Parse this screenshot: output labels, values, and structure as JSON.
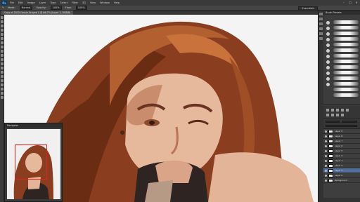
{
  "app": {
    "logo": "Ps",
    "menu": [
      "File",
      "Edit",
      "Image",
      "Layer",
      "Type",
      "Select",
      "Filter",
      "3D",
      "View",
      "Window",
      "Help"
    ],
    "window_controls": [
      "–",
      "□",
      "✕"
    ]
  },
  "options_bar": {
    "mode_label": "Mode:",
    "mode_value": "Normal",
    "opacity_label": "Opacity:",
    "opacity_value": "100%",
    "flow_label": "Flow:",
    "flow_value": "100%",
    "workspace": "Essentials"
  },
  "document": {
    "tab_title": "Copy of 2015 Cassie Grayed 1 @ 66.7% (Layer 1, RGB/8)"
  },
  "navigator": {
    "title": "Navigator"
  },
  "brush_panel": {
    "title": "Brush Presets"
  },
  "layers": {
    "rows": [
      {
        "name": "Layer 9",
        "selected": false
      },
      {
        "name": "Layer 8",
        "selected": false
      },
      {
        "name": "Layer 7",
        "selected": false
      },
      {
        "name": "Layer 6",
        "selected": false
      },
      {
        "name": "Layer 5",
        "selected": false
      },
      {
        "name": "Layer 4",
        "selected": false
      },
      {
        "name": "Layer 3",
        "selected": false
      },
      {
        "name": "Layer 2",
        "selected": false
      },
      {
        "name": "Layer 1",
        "selected": true
      },
      {
        "name": "Layer 0",
        "selected": false
      },
      {
        "name": "Background",
        "selected": false
      }
    ]
  },
  "colors": {
    "accent": "#516f9a",
    "canvas_bg": "#f4f4f4"
  }
}
